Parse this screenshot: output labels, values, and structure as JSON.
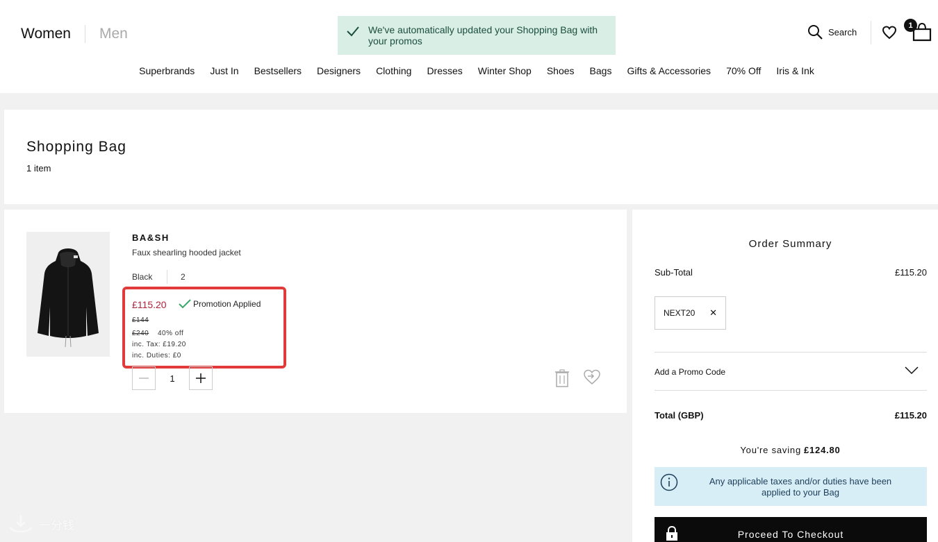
{
  "header": {
    "gender_women": "Women",
    "gender_men": "Men",
    "search_label": "Search",
    "bag_count": "1"
  },
  "toast": {
    "message": "We've automatically updated your Shopping Bag with your promos"
  },
  "nav": [
    "Superbrands",
    "Just In",
    "Bestsellers",
    "Designers",
    "Clothing",
    "Dresses",
    "Winter Shop",
    "Shoes",
    "Bags",
    "Gifts & Accessories",
    "70% Off",
    "Iris & Ink"
  ],
  "bag": {
    "title": "Shopping Bag",
    "item_count": "1 item"
  },
  "item": {
    "brand": "BA&SH",
    "name": "Faux shearling hooded jacket",
    "color": "Black",
    "size": "2",
    "price_now": "£115.20",
    "promotion_label": "Promotion Applied",
    "price_was_1": "£144",
    "price_was_2": "£240",
    "percent_off": "40% off",
    "tax": "inc. Tax: £19.20",
    "duties": "inc. Duties: £0",
    "quantity": "1"
  },
  "summary": {
    "title": "Order Summary",
    "subtotal_label": "Sub-Total",
    "subtotal_value": "£115.20",
    "promo_code": "NEXT20",
    "remove_code_glyph": "✕",
    "add_promo_label": "Add a Promo Code",
    "total_label": "Total (GBP)",
    "total_value": "£115.20",
    "saving_label": "You're saving",
    "saving_value": "£124.80",
    "info_message": "Any applicable taxes and/or duties have been applied to your Bag",
    "checkout_label": "Proceed To Checkout"
  },
  "watermark": {
    "text": "一分钱"
  },
  "colors": {
    "toast_bg": "#d9efe6",
    "sale_red": "#b0213a",
    "highlight_border": "#e03a3a",
    "info_bg": "#d8eef7",
    "checkout_bg": "#0b0b0b",
    "check_green": "#3aa66a"
  }
}
